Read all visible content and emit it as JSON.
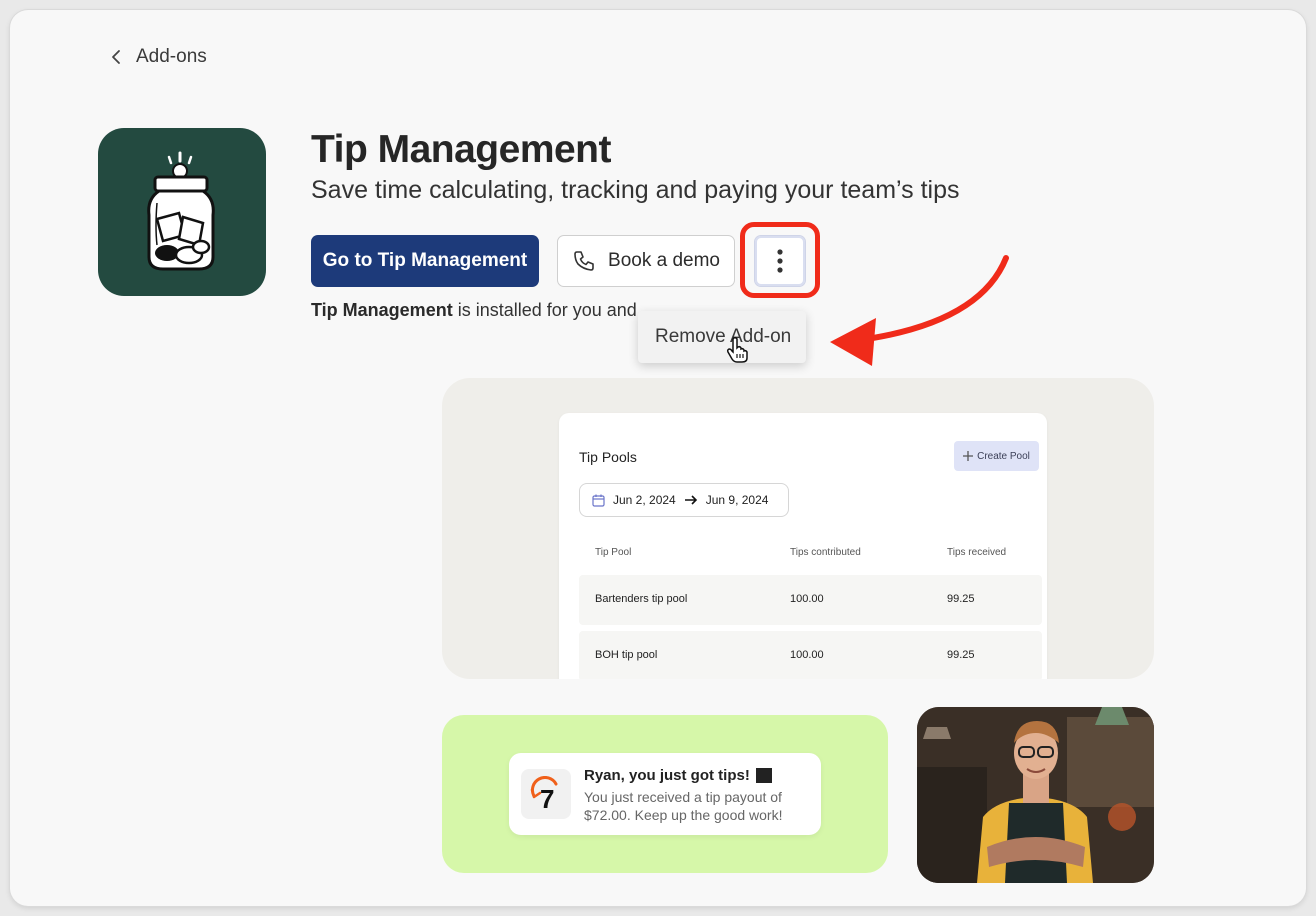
{
  "nav": {
    "back_label": "Add-ons"
  },
  "header": {
    "title": "Tip Management",
    "subtitle": "Save time calculating, tracking and paying your team’s tips"
  },
  "actions": {
    "primary_label": "Go to Tip Management",
    "demo_label": "Book a demo",
    "more_icon": "more-vertical-icon"
  },
  "status": {
    "app_name": "Tip Management",
    "installed_text": " is installed for you and"
  },
  "menu": {
    "items": [
      "Remove Add-on"
    ]
  },
  "preview": {
    "tip_pools": {
      "title": "Tip Pools",
      "create_label": "Create Pool",
      "date_start": "Jun 2, 2024",
      "date_end": "Jun 9, 2024",
      "columns": [
        "Tip Pool",
        "Tips contributed",
        "Tips received"
      ],
      "rows": [
        [
          "Bartenders tip pool",
          "100.00",
          "99.25"
        ],
        [
          "BOH tip pool",
          "100.00",
          "99.25"
        ]
      ]
    },
    "notification": {
      "icon_text": "7",
      "title": "Ryan, you just got tips!",
      "body": "You just received a tip payout of $72.00. Keep up the good work!"
    }
  },
  "colors": {
    "primary": "#1d3a7a",
    "app_icon_bg": "#234a40",
    "highlight": "#f02b1a",
    "green_card": "#d6f7a9"
  }
}
